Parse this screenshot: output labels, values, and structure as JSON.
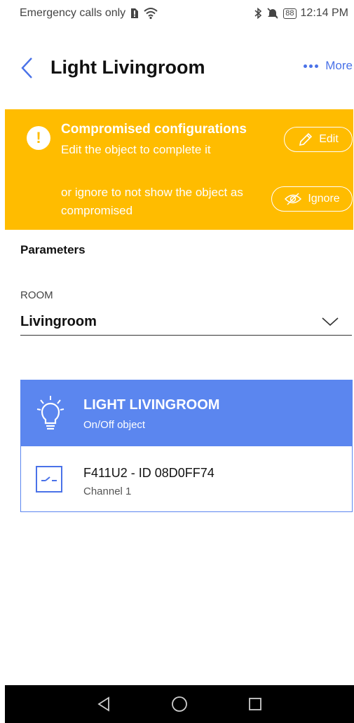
{
  "status_bar": {
    "carrier": "Emergency calls only",
    "battery": "88",
    "time": "12:14 PM"
  },
  "header": {
    "title": "Light Livingroom",
    "more_label": "More"
  },
  "banner": {
    "title": "Compromised configurations",
    "subtitle": "Edit the object to complete it",
    "text2": "or ignore to not show the object as compromised",
    "edit_label": "Edit",
    "ignore_label": "Ignore",
    "color": "#ffbc00"
  },
  "parameters": {
    "title": "Parameters",
    "room_label": "ROOM",
    "room_value": "Livingroom"
  },
  "object_card": {
    "title": "LIGHT LIVINGROOM",
    "subtitle": "On/Off object",
    "device_name": "F411U2 - ID 08D0FF74",
    "channel": "Channel 1",
    "accent": "#5b86ef"
  },
  "icons": {
    "back": "chevron-left-icon",
    "more": "ellipsis-icon",
    "warning": "exclamation-icon",
    "edit": "pencil-icon",
    "ignore": "eye-off-icon",
    "room_dropdown": "chevron-down-icon",
    "object": "lightbulb-icon",
    "device": "switch-icon"
  }
}
